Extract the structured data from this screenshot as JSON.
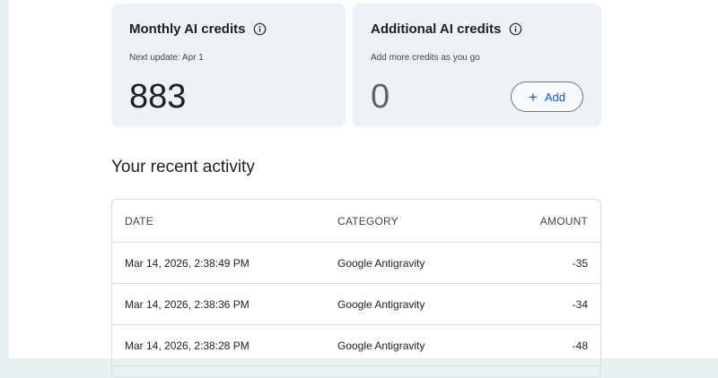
{
  "monthly_card": {
    "title": "Monthly AI credits",
    "subtitle": "Next update: Apr 1",
    "value": "883"
  },
  "additional_card": {
    "title": "Additional AI credits",
    "subtitle": "Add more credits as you go",
    "value": "0",
    "add_button_label": "Add"
  },
  "activity": {
    "title": "Your recent activity",
    "columns": {
      "date": "DATE",
      "category": "CATEGORY",
      "amount": "AMOUNT"
    },
    "rows": [
      {
        "date": "Mar 14, 2026, 2:38:49 PM",
        "category": "Google Antigravity",
        "amount": "-35"
      },
      {
        "date": "Mar 14, 2026, 2:38:36 PM",
        "category": "Google Antigravity",
        "amount": "-34"
      },
      {
        "date": "Mar 14, 2026, 2:38:28 PM",
        "category": "Google Antigravity",
        "amount": "-48"
      }
    ]
  },
  "icons": {
    "info": "info-icon",
    "add": "plus-icon"
  },
  "colors": {
    "card_background": "#eef1f6",
    "accent": "#0b57d0",
    "page_edge": "#e6f1f1"
  }
}
